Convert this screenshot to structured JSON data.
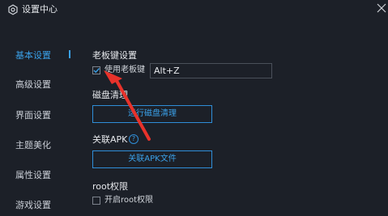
{
  "window": {
    "title": "设置中心",
    "logo_icon": "settings-gear-icon",
    "close_icon": "close-icon"
  },
  "sidebar": {
    "items": [
      {
        "label": "基本设置",
        "active": true
      },
      {
        "label": "高级设置",
        "active": false
      },
      {
        "label": "界面设置",
        "active": false
      },
      {
        "label": "主题美化",
        "active": false
      },
      {
        "label": "属性设置",
        "active": false
      },
      {
        "label": "游戏设置",
        "active": false
      }
    ]
  },
  "boss_key": {
    "heading": "老板键设置",
    "checkbox_label": "使用老板键",
    "checked": true,
    "hotkey_value": "Alt+Z"
  },
  "disk_clean": {
    "heading": "磁盘清理",
    "button_label": "运行磁盘清理"
  },
  "apk_assoc": {
    "heading": "关联APK",
    "help_icon": "?",
    "button_label": "关联APK文件"
  },
  "root": {
    "heading": "root权限",
    "checkbox_label": "开启root权限",
    "checked": false
  },
  "colors": {
    "accent": "#3aa0e8",
    "background": "#1c2028",
    "annotation_arrow": "#e8322b"
  }
}
